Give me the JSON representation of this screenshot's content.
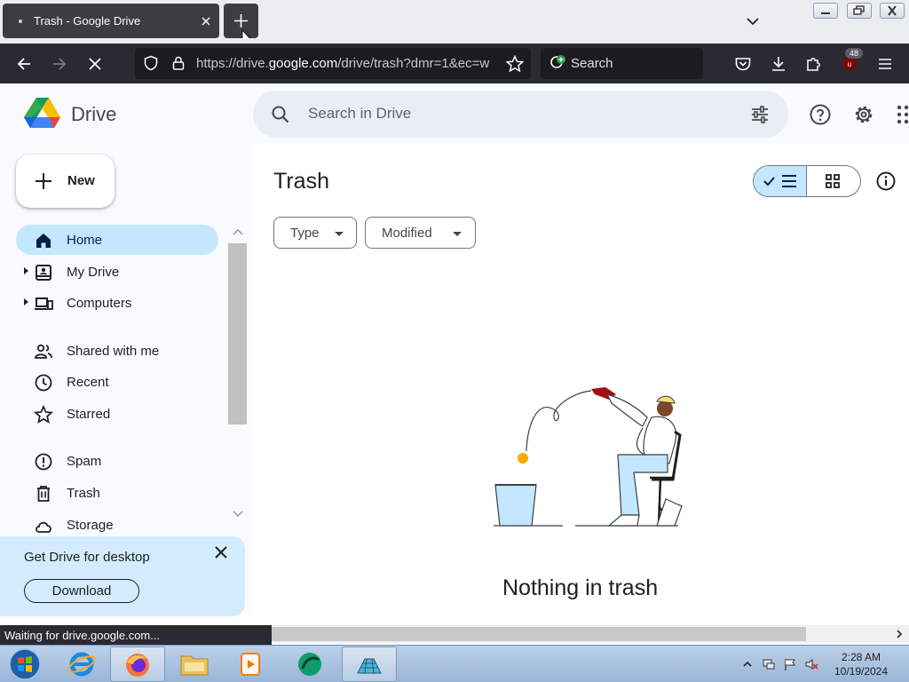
{
  "browser": {
    "tab": {
      "title": "Trash - Google Drive"
    },
    "url": {
      "prefix": "https://drive.",
      "host": "google.com",
      "path": "/drive/trash?dmr=1&ec=w"
    },
    "search_label": "Search",
    "extension_badge": "48",
    "status_text": "Waiting for drive.google.com..."
  },
  "drive": {
    "brand": "Drive",
    "search_placeholder": "Search in Drive",
    "new_label": "New",
    "nav": [
      {
        "label": "Home",
        "active": true,
        "icon": "home-icon"
      },
      {
        "label": "My Drive",
        "expandable": true,
        "icon": "my-drive-icon"
      },
      {
        "label": "Computers",
        "expandable": true,
        "icon": "computer-icon"
      },
      {
        "label": "Shared with me",
        "icon": "people-icon"
      },
      {
        "label": "Recent",
        "icon": "clock-icon"
      },
      {
        "label": "Starred",
        "icon": "star-icon"
      },
      {
        "label": "Spam",
        "icon": "spam-icon"
      },
      {
        "label": "Trash",
        "icon": "trash-icon"
      },
      {
        "label": "Storage",
        "icon": "cloud-icon"
      }
    ],
    "promo": {
      "title": "Get Drive for desktop",
      "button": "Download"
    },
    "page_title": "Trash",
    "filters": [
      {
        "label": "Type"
      },
      {
        "label": "Modified"
      }
    ],
    "empty_state": {
      "title": "Nothing in trash"
    }
  },
  "taskbar": {
    "time": "2:28 AM",
    "date": "10/19/2024"
  },
  "colors": {
    "accent": "#c2e7ff",
    "sidebar_bg": "#f8fafd",
    "firefox_toolbar": "#2b2a33",
    "promo_bg": "#d3ecfd"
  }
}
